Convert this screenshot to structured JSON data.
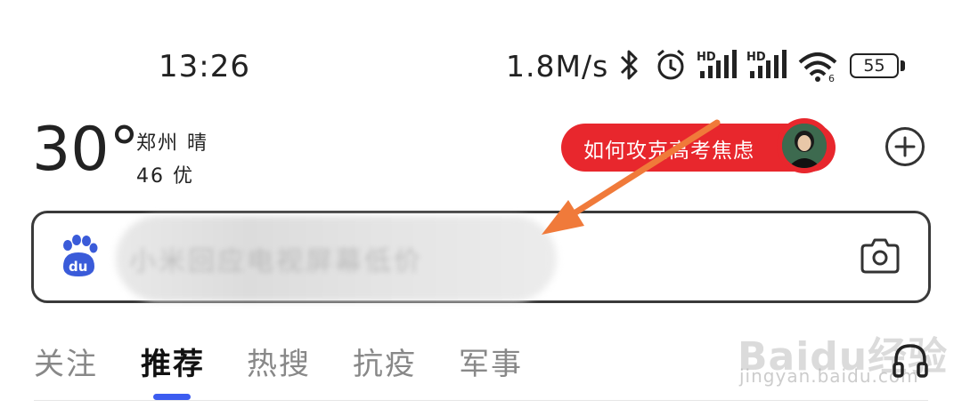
{
  "status_bar": {
    "time": "13:26",
    "net_speed": "1.8M/s",
    "battery": "55",
    "icons": [
      "bluetooth-icon",
      "alarm-icon",
      "signal-hd-icon",
      "signal-hd-icon",
      "wifi-icon",
      "battery-icon"
    ]
  },
  "weather": {
    "temperature": "30°",
    "city_condition": "郑州 晴",
    "air_quality": "46 优"
  },
  "hot_topic": {
    "text": "如何攻克高考焦虑"
  },
  "search": {
    "placeholder": "小米回应电视屏幕低价"
  },
  "tabs": [
    {
      "label": "关注",
      "active": false
    },
    {
      "label": "推荐",
      "active": true
    },
    {
      "label": "热搜",
      "active": false
    },
    {
      "label": "抗疫",
      "active": false
    },
    {
      "label": "军事",
      "active": false
    }
  ],
  "watermark": {
    "main": "Baidu经验",
    "sub": "jingyan.baidu.com"
  },
  "colors": {
    "accent_red": "#e8272d",
    "tab_indicator": "#3c5cf0",
    "baidu_blue": "#3a5bd9",
    "arrow_orange": "#f07a3a"
  }
}
